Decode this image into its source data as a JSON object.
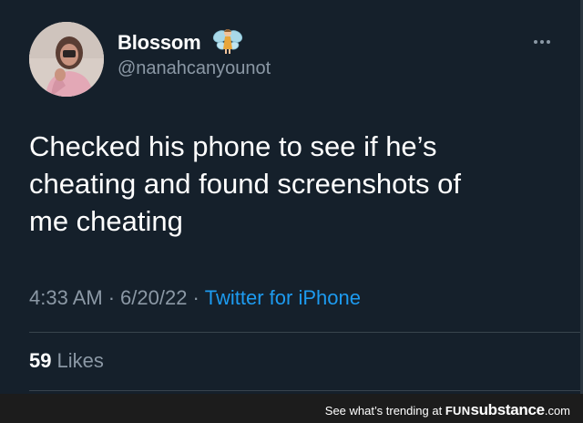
{
  "tweet": {
    "author": {
      "display_name": "Blossom",
      "handle": "@nanahcanyounot",
      "avatar_icon": "profile-photo",
      "badge_icon": "fairy-emoji"
    },
    "more_icon": "more-options-icon",
    "text_lines": [
      "Checked his phone to see if he’s",
      "cheating and found screenshots of",
      "me cheating"
    ],
    "time": "4:33 AM",
    "separator": "·",
    "date": "6/20/22",
    "source": "Twitter for iPhone",
    "likes_count": "59",
    "likes_label": "Likes"
  },
  "footer": {
    "prefix": "See what’s trending at",
    "brand_part1": "FUN",
    "brand_part2": "substance",
    "brand_part3": ".com"
  },
  "colors": {
    "background": "#15202b",
    "text_primary": "#ffffff",
    "text_secondary": "#8b98a5",
    "link": "#1d9bf0",
    "footer_bg": "#1c1c1c"
  }
}
